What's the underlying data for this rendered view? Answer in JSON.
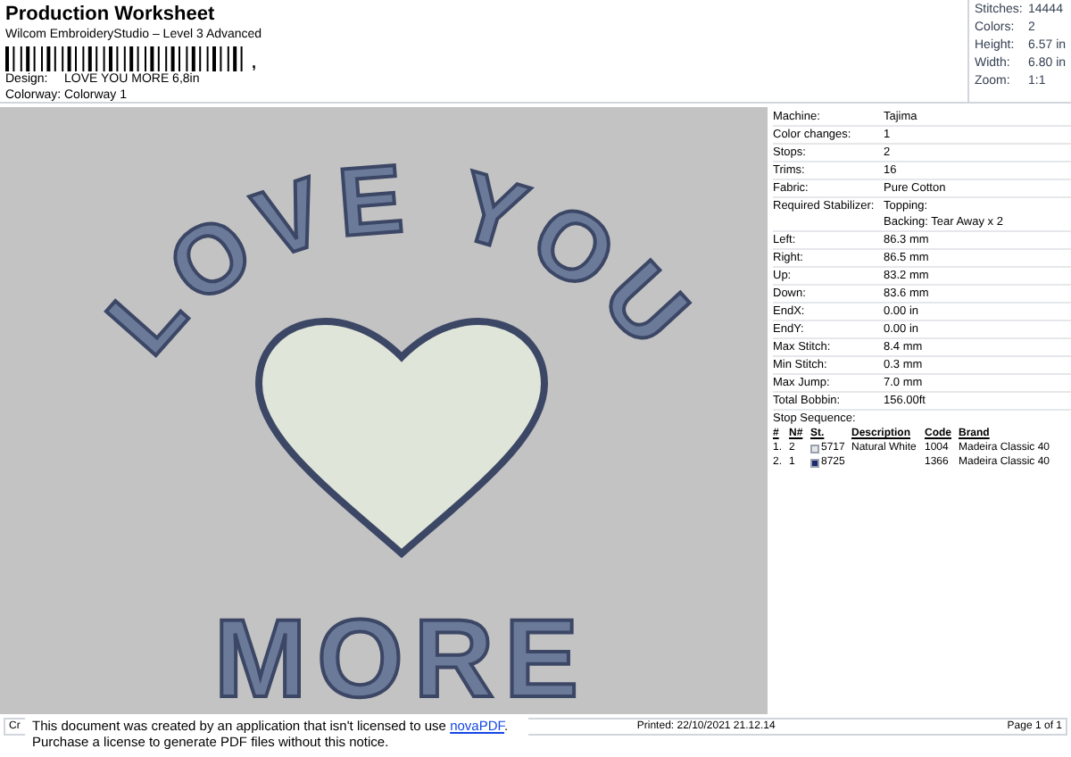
{
  "header": {
    "title": "Production Worksheet",
    "subtitle": "Wilcom EmbroideryStudio – Level 3 Advanced",
    "barcode_suffix": ",",
    "fields": [
      {
        "label": "Design:",
        "value": "LOVE YOU MORE 6,8in"
      },
      {
        "label": "Colorway:",
        "value": "Colorway 1"
      }
    ]
  },
  "summary": [
    {
      "label": "Stitches:",
      "value": "14444"
    },
    {
      "label": "Colors:",
      "value": "2"
    },
    {
      "label": "Height:",
      "value": "6.57 in"
    },
    {
      "label": "Width:",
      "value": "6.80 in"
    },
    {
      "label": "Zoom:",
      "value": "1:1"
    }
  ],
  "design": {
    "top_text": "LOVE YOU",
    "bottom_text": "MORE"
  },
  "details": [
    {
      "label": "Machine:",
      "value": [
        "Tajima"
      ]
    },
    {
      "label": "Color changes:",
      "value": [
        "1"
      ]
    },
    {
      "label": "Stops:",
      "value": [
        "2"
      ]
    },
    {
      "label": "Trims:",
      "value": [
        "16"
      ]
    },
    {
      "label": "Fabric:",
      "value": [
        "Pure Cotton"
      ]
    },
    {
      "label": "Required Stabilizer:",
      "value": [
        "Topping:",
        "Backing: Tear Away x 2"
      ]
    },
    {
      "label": "Left:",
      "value": [
        "86.3 mm"
      ]
    },
    {
      "label": "Right:",
      "value": [
        "86.5 mm"
      ]
    },
    {
      "label": "Up:",
      "value": [
        "83.2 mm"
      ]
    },
    {
      "label": "Down:",
      "value": [
        "83.6 mm"
      ]
    },
    {
      "label": "EndX:",
      "value": [
        "0.00 in"
      ]
    },
    {
      "label": "EndY:",
      "value": [
        "0.00 in"
      ]
    },
    {
      "label": "Max Stitch:",
      "value": [
        "8.4 mm"
      ]
    },
    {
      "label": "Min Stitch:",
      "value": [
        "0.3 mm"
      ]
    },
    {
      "label": "Max Jump:",
      "value": [
        "7.0 mm"
      ]
    },
    {
      "label": "Total Bobbin:",
      "value": [
        "156.00ft"
      ]
    }
  ],
  "stop_sequence": {
    "title": "Stop Sequence:",
    "columns": [
      "#",
      "N#",
      "St.",
      "Description",
      "Code",
      "Brand"
    ],
    "rows": [
      {
        "index": "1.",
        "needle": "2",
        "color": "#e6e6e6",
        "stitches": "5717",
        "description": "Natural White",
        "code": "1004",
        "brand": "Madeira Classic 40"
      },
      {
        "index": "2.",
        "needle": "1",
        "color": "#1f2a6e",
        "stitches": "8725",
        "description": "",
        "code": "1366",
        "brand": "Madeira Classic 40"
      }
    ]
  },
  "footer": {
    "left": "Cr",
    "printed": "Printed: 22/10/2021 21.12.14",
    "page": "Page 1 of 1"
  },
  "notice": {
    "text": "This document was created by an application that isn't licensed to use ",
    "link": "novaPDF",
    "after": ".",
    "line2": "Purchase a license to generate PDF files without this notice."
  }
}
